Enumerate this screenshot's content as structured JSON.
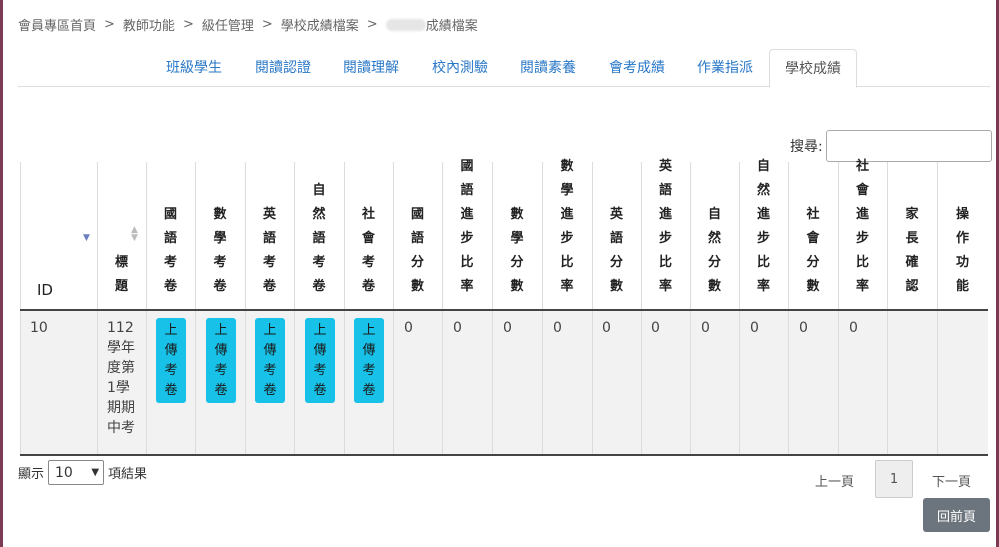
{
  "breadcrumb": {
    "items": [
      "會員專區首頁",
      "教師功能",
      "級任管理",
      "學校成績檔案"
    ],
    "last_suffix": "成績檔案",
    "separator": ">"
  },
  "tabs": [
    {
      "label": "班級學生",
      "active": false
    },
    {
      "label": "閱讀認證",
      "active": false
    },
    {
      "label": "閱讀理解",
      "active": false
    },
    {
      "label": "校內測驗",
      "active": false
    },
    {
      "label": "閱讀素養",
      "active": false
    },
    {
      "label": "會考成績",
      "active": false
    },
    {
      "label": "作業指派",
      "active": false
    },
    {
      "label": "學校成績",
      "active": true
    }
  ],
  "search": {
    "label": "搜尋:",
    "placeholder": ""
  },
  "table": {
    "columns": [
      {
        "label": "ID"
      },
      {
        "label": "標題"
      },
      {
        "label": "國語考卷"
      },
      {
        "label": "數學考卷"
      },
      {
        "label": "英語考卷"
      },
      {
        "label": "自然語考卷"
      },
      {
        "label": "社會考卷"
      },
      {
        "label": "國語分數"
      },
      {
        "label": "國語進步比率"
      },
      {
        "label": "數學分數"
      },
      {
        "label": "數學進步比率"
      },
      {
        "label": "英語分數"
      },
      {
        "label": "英語進步比率"
      },
      {
        "label": "自然分數"
      },
      {
        "label": "自然進步比率"
      },
      {
        "label": "社會分數"
      },
      {
        "label": "社會進步比率"
      },
      {
        "label": "家長確認"
      },
      {
        "label": "操作功能"
      }
    ],
    "rows": [
      {
        "id": "10",
        "title": "112學年度第1學期期中考",
        "upload_label": "上傳考卷",
        "scores": [
          "0",
          "0",
          "0",
          "0",
          "0",
          "0",
          "0",
          "0",
          "0",
          "0"
        ]
      }
    ]
  },
  "length": {
    "prefix": "顯示",
    "value": "10",
    "suffix": "項結果"
  },
  "pagination": {
    "prev": "上一頁",
    "current": "1",
    "next": "下一頁"
  },
  "back_button": "回前頁",
  "colors": {
    "accent": "#2a78c7",
    "upload": "#17c1e8",
    "back": "#6c757d",
    "frame": "#7b3b54"
  }
}
